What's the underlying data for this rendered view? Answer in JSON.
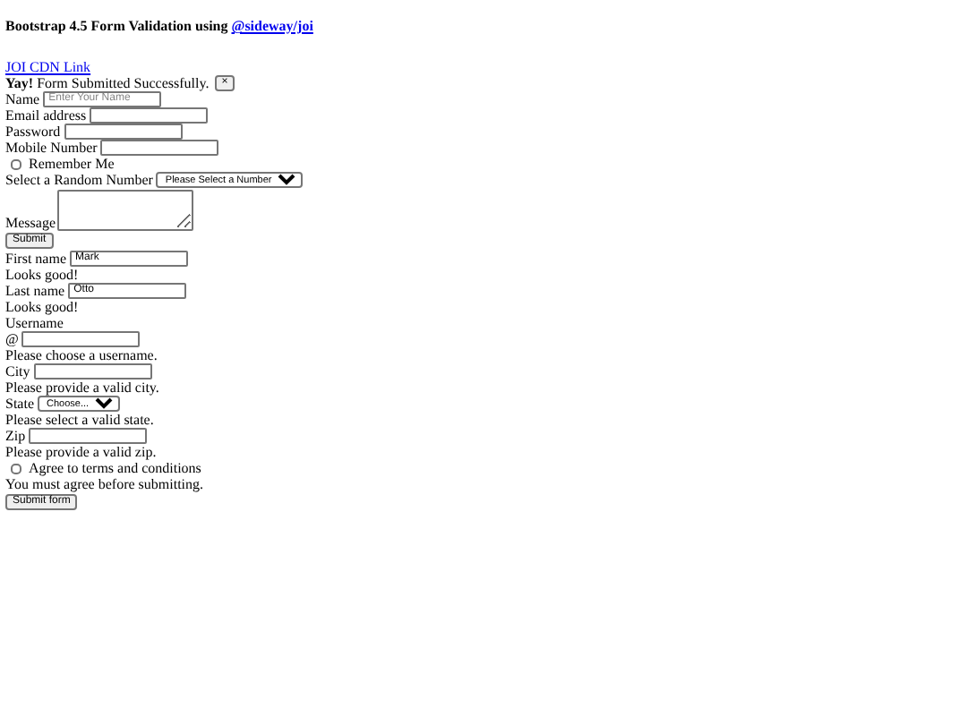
{
  "heading": {
    "text": "Bootstrap 4.5 Form Validation using ",
    "link": "@sideway/joi"
  },
  "cdn_link": "JOI CDN Link",
  "alert": {
    "strong": "Yay!",
    "message": "Form Submitted Successfully.",
    "close": "×"
  },
  "form1": {
    "items": [
      {
        "kind": "input",
        "label": "Name",
        "placeholder": "Enter Your Name"
      },
      {
        "kind": "input",
        "label": "Email address"
      },
      {
        "kind": "input",
        "label": "Password"
      },
      {
        "kind": "input",
        "label": "Mobile Number"
      },
      {
        "kind": "checkbox",
        "label": "Remember Me",
        "checked": false
      },
      {
        "kind": "select",
        "label": "Select a Random Number",
        "value": "Please Select a Number"
      },
      {
        "kind": "textarea",
        "label": "Message"
      }
    ],
    "submit": "Submit"
  },
  "form2": {
    "items": [
      {
        "kind": "input",
        "label": "First name",
        "value": "Mark"
      },
      {
        "kind": "text",
        "text": "Looks good!"
      },
      {
        "kind": "input",
        "label": "Last name",
        "value": "Otto"
      },
      {
        "kind": "text",
        "text": "Looks good!"
      },
      {
        "kind": "text",
        "text": "Username"
      },
      {
        "kind": "input",
        "label": "@"
      },
      {
        "kind": "text",
        "text": "Please choose a username."
      },
      {
        "kind": "input",
        "label": "City"
      },
      {
        "kind": "text",
        "text": "Please provide a valid city."
      },
      {
        "kind": "select",
        "label": "State",
        "value": "Choose..."
      },
      {
        "kind": "text",
        "text": "Please select a valid state."
      },
      {
        "kind": "input",
        "label": "Zip"
      },
      {
        "kind": "text",
        "text": "Please provide a valid zip."
      },
      {
        "kind": "checkbox",
        "label": "Agree to terms and conditions",
        "checked": false
      },
      {
        "kind": "text",
        "text": "You must agree before submitting."
      }
    ],
    "submit": "Submit form"
  }
}
